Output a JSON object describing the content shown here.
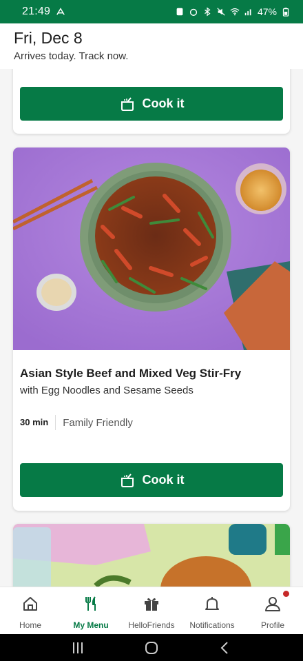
{
  "status_bar": {
    "time": "21:49",
    "battery": "47%"
  },
  "header": {
    "date": "Fri, Dec 8",
    "subtitle": "Arrives today. Track now."
  },
  "cards": [
    {
      "cta": "Cook it"
    },
    {
      "title": "Asian Style Beef and Mixed Veg Stir-Fry",
      "subtitle": "with Egg Noodles and Sesame Seeds",
      "time": "30 min",
      "tag": "Family Friendly",
      "cta": "Cook it"
    }
  ],
  "bottom_nav": [
    {
      "label": "Home",
      "icon": "home-icon"
    },
    {
      "label": "My Menu",
      "icon": "fork-knife-icon",
      "active": true
    },
    {
      "label": "HelloFriends",
      "icon": "gift-icon"
    },
    {
      "label": "Notifications",
      "icon": "bell-icon"
    },
    {
      "label": "Profile",
      "icon": "profile-icon"
    }
  ],
  "colors": {
    "brand": "#067a46",
    "badge": "#c62828"
  }
}
